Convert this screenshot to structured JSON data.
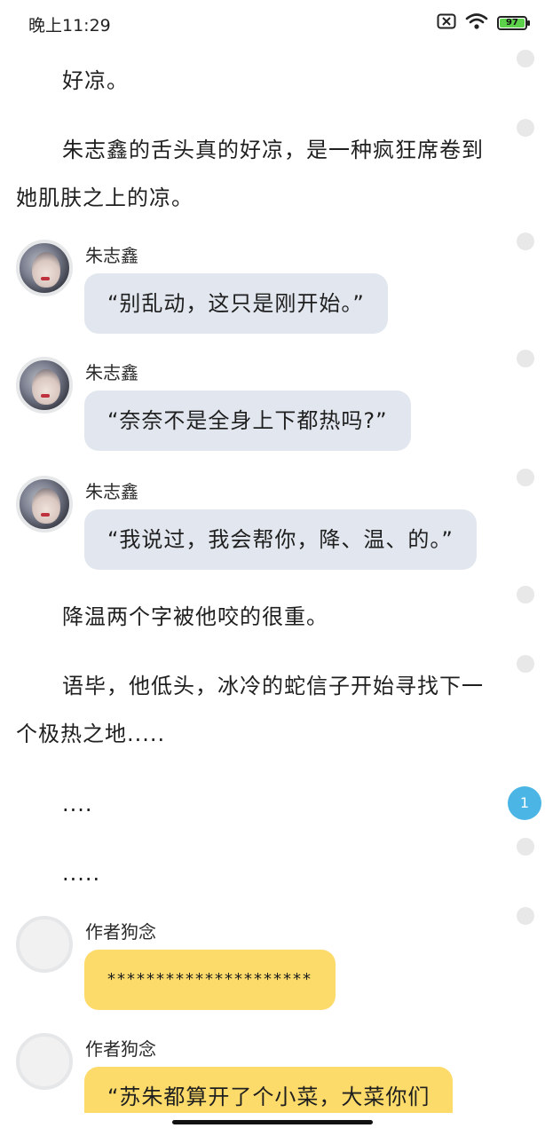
{
  "status_bar": {
    "time": "晚上11:29",
    "battery_level": "97",
    "battery_color": "#5cd14a",
    "icons": [
      "close-box-icon",
      "wifi-icon",
      "battery-icon"
    ]
  },
  "content": {
    "p1": "好凉。",
    "p2": "朱志鑫的舌头真的好凉，是一种疯狂席卷到她肌肤之上的凉。",
    "chat1": {
      "name": "朱志鑫",
      "text": "“别乱动，这只是刚开始。”"
    },
    "chat2": {
      "name": "朱志鑫",
      "text": "“奈奈不是全身上下都热吗?”"
    },
    "chat3": {
      "name": "朱志鑫",
      "text": "“我说过，我会帮你，降、温、的。”"
    },
    "p3": "降温两个字被他咬的很重。",
    "p4": "语毕，他低头，冰冷的蛇信子开始寻找下一个极热之地.....",
    "p5": "....",
    "p6": ".....",
    "chat4": {
      "name": "作者狗念",
      "text": "*********************"
    },
    "chat5": {
      "name": "作者狗念",
      "text": "“苏朱都算开了个小菜，大菜你们"
    }
  },
  "sidebar": {
    "comment_badge": "1",
    "badge_color": "#4bb5e5"
  },
  "colors": {
    "bubble_gray": "#e2e7ef",
    "bubble_yellow": "#fddb6a"
  }
}
